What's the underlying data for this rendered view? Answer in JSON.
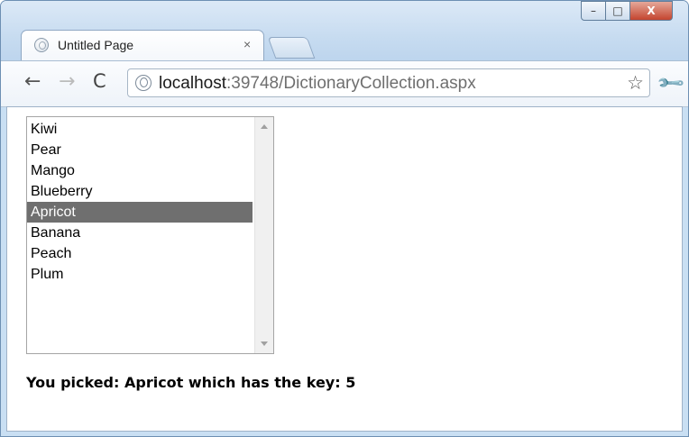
{
  "browser": {
    "tab_title": "Untitled Page",
    "tab_close": "×",
    "window_buttons": {
      "minimize": "–",
      "maximize": "□",
      "close": "X"
    },
    "nav": {
      "back": "←",
      "forward": "→",
      "reload": "C"
    },
    "address": {
      "host": "localhost",
      "path": ":39748/DictionaryCollection.aspx"
    },
    "bookmark_star": "☆",
    "menu_wrench": "🔧"
  },
  "page": {
    "listbox": {
      "items": [
        "Kiwi",
        "Pear",
        "Mango",
        "Blueberry",
        "Apricot",
        "Banana",
        "Peach",
        "Plum"
      ],
      "selected": "Apricot"
    },
    "result_text": "You picked: Apricot which has the key: 5"
  }
}
